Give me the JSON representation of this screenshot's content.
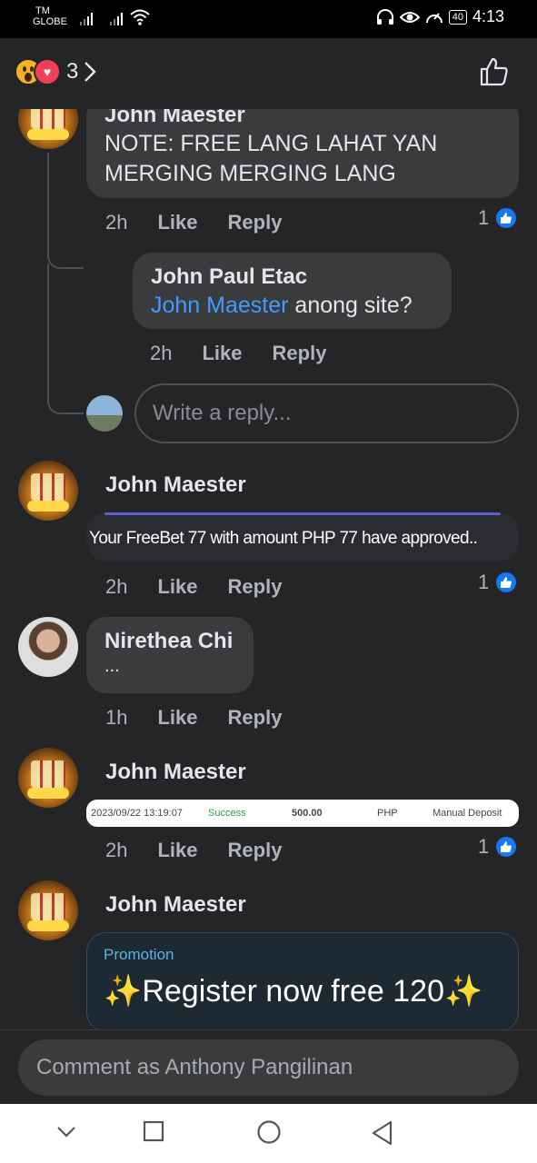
{
  "status_bar": {
    "carrier_line1": "TM",
    "carrier_line2": "GLOBE",
    "battery": "40",
    "time": "4:13"
  },
  "header": {
    "reaction_icons": [
      "wow-icon",
      "love-icon"
    ],
    "reaction_count": "3",
    "like_icon": "thumbs-up-outline-icon"
  },
  "comments": [
    {
      "author": "John Maester",
      "text": "NOTE: FREE LANG LAHAT YAN MERGING MERGING LANG",
      "time": "2h",
      "like": "Like",
      "reply": "Reply",
      "likes": "1"
    },
    {
      "author": "John Paul Etac",
      "mention": "John Maester",
      "text": " anong site?",
      "time": "2h",
      "like": "Like",
      "reply": "Reply"
    },
    {
      "author": "John Maester",
      "image_text": "Your FreeBet 77 with amount PHP 77 have approved..",
      "time": "2h",
      "like": "Like",
      "reply": "Reply",
      "likes": "1"
    },
    {
      "author": "Nirethea Chi",
      "text": "...",
      "time": "1h",
      "like": "Like",
      "reply": "Reply"
    },
    {
      "author": "John Maester",
      "transaction": {
        "datetime": "2023/09/22 13:19:07",
        "status": "Success",
        "amount": "500.00",
        "currency": "PHP",
        "method": "Manual Deposit"
      },
      "time": "2h",
      "like": "Like",
      "reply": "Reply",
      "likes": "1"
    },
    {
      "author": "John Maester",
      "promo_tag": "Promotion",
      "promo_text": "Register now free 120"
    }
  ],
  "reply_placeholder": "Write a reply...",
  "composer_placeholder": "Comment as Anthony Pangilinan",
  "colors": {
    "background": "#242526",
    "bubble": "#3a3b3c",
    "mention": "#4599ff",
    "like_blue": "#1877f2"
  }
}
